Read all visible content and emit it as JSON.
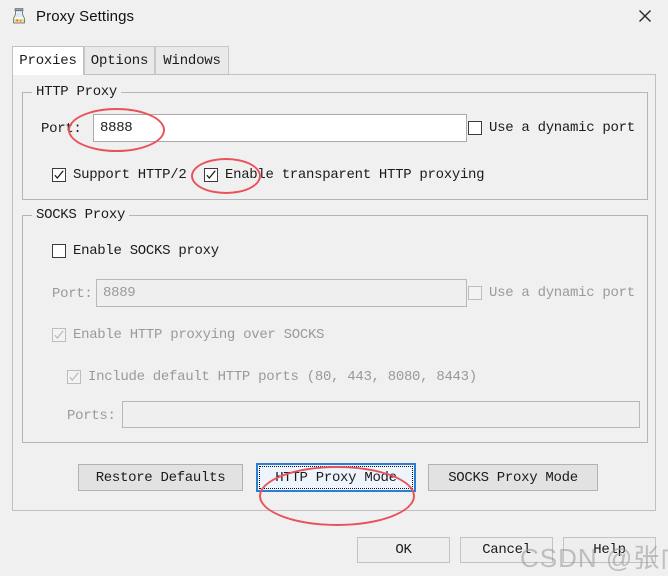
{
  "window": {
    "title": "Proxy Settings",
    "icon": "charles-proxy-icon",
    "close_label": "✕"
  },
  "tabs": [
    {
      "label": "Proxies",
      "active": true
    },
    {
      "label": "Options",
      "active": false
    },
    {
      "label": "Windows",
      "active": false
    }
  ],
  "http_proxy": {
    "group_title": "HTTP Proxy",
    "port_label": "Port:",
    "port_value": "8888",
    "dynamic_port_label": "Use a dynamic port",
    "dynamic_port_checked": false,
    "support_http2_label": "Support HTTP/2",
    "support_http2_checked": true,
    "transparent_label": "Enable transparent HTTP proxying",
    "transparent_checked": true
  },
  "socks_proxy": {
    "group_title": "SOCKS Proxy",
    "enable_label": "Enable SOCKS proxy",
    "enable_checked": false,
    "port_label": "Port:",
    "port_value": "8889",
    "dynamic_port_label": "Use a dynamic port",
    "dynamic_port_checked": false,
    "http_over_socks_label": "Enable HTTP proxying over SOCKS",
    "http_over_socks_checked": true,
    "default_ports_label": "Include default HTTP ports (80, 443, 8080, 8443)",
    "default_ports_checked": true,
    "ports_label": "Ports:",
    "ports_value": ""
  },
  "mode_buttons": {
    "restore_defaults": "Restore Defaults",
    "http_proxy_mode": "HTTP Proxy Mode",
    "socks_proxy_mode": "SOCKS Proxy Mode",
    "focused": "http_proxy_mode"
  },
  "dialog_buttons": {
    "ok": "OK",
    "cancel": "Cancel",
    "help": "Help"
  },
  "annotations": {
    "color": "#e8535a",
    "targets": [
      "http-port-value",
      "transparent-proxy-checkbox",
      "http-proxy-mode-button"
    ]
  },
  "watermark": {
    "text": "CSDN @张向恒"
  }
}
